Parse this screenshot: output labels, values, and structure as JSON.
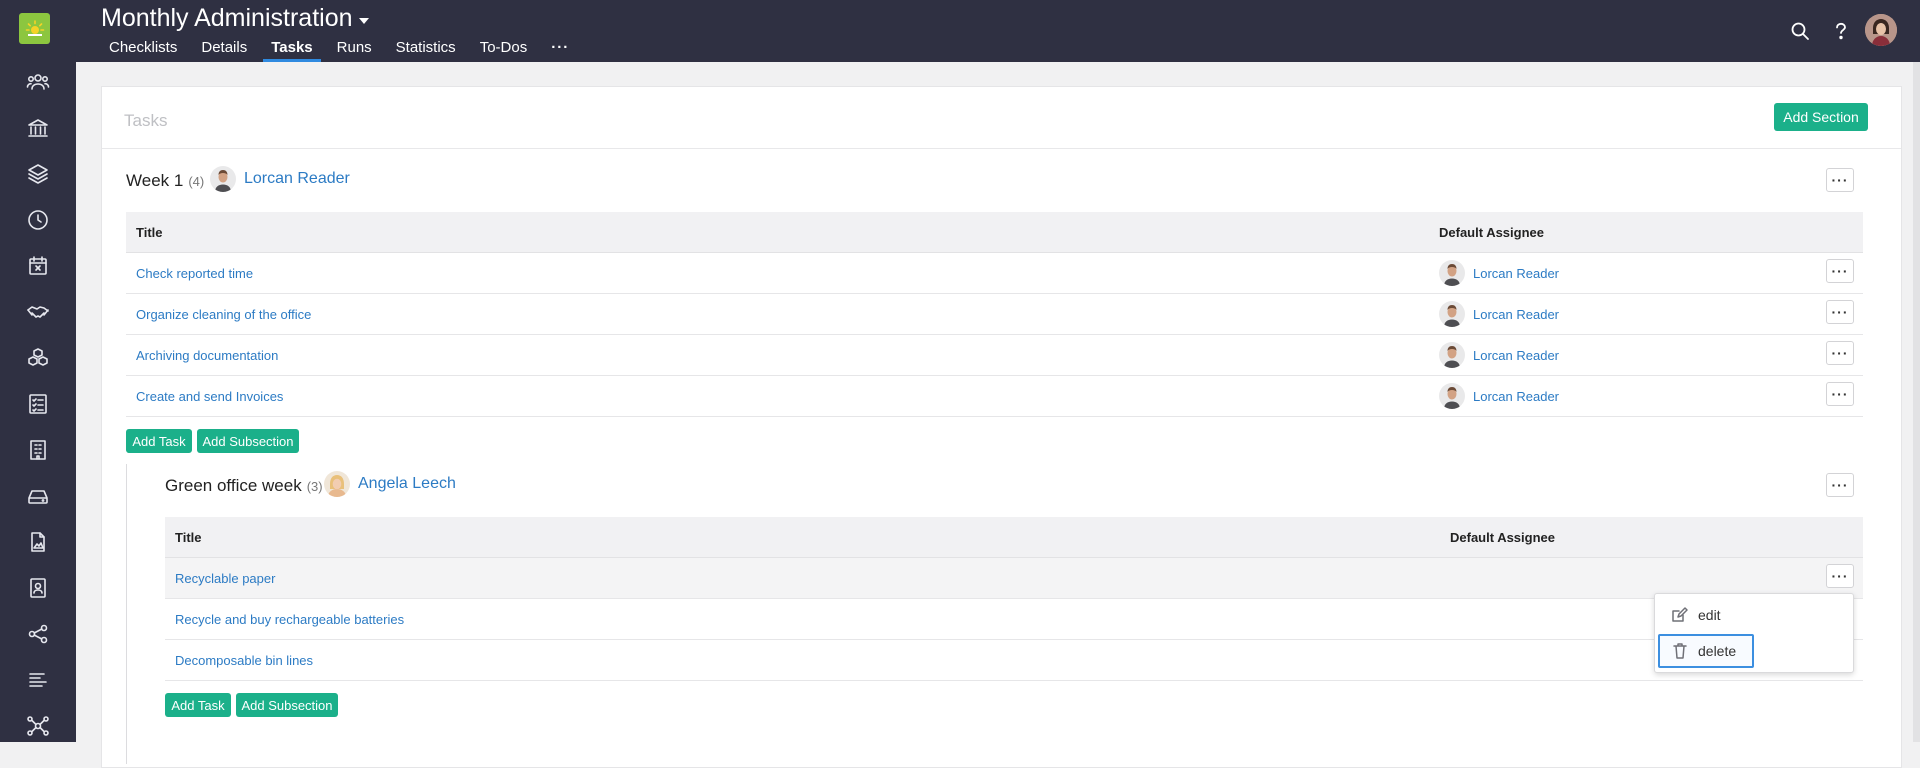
{
  "app": {
    "title": "Monthly Administration"
  },
  "tabs": [
    {
      "label": "Checklists"
    },
    {
      "label": "Details"
    },
    {
      "label": "Tasks",
      "active": true
    },
    {
      "label": "Runs"
    },
    {
      "label": "Statistics"
    },
    {
      "label": "To-Dos"
    },
    {
      "label": "···"
    }
  ],
  "sidebar_icons": [
    "users-icon",
    "bank-icon",
    "layers-icon",
    "clock-icon",
    "calendar-x-icon",
    "handshake-icon",
    "boxes-icon",
    "checklist-icon",
    "building-icon",
    "drive-icon",
    "document-image-icon",
    "contact-card-icon",
    "share-icon",
    "list-icon",
    "network-icon"
  ],
  "card": {
    "title": "Tasks",
    "add_section_label": "Add Section"
  },
  "sections": [
    {
      "title": "Week 1",
      "count": "(4)",
      "owner": "Lorcan Reader",
      "columns": {
        "title": "Title",
        "assignee": "Default Assignee"
      },
      "tasks": [
        {
          "title": "Check reported time",
          "assignee": "Lorcan Reader"
        },
        {
          "title": "Organize cleaning of the office",
          "assignee": "Lorcan Reader"
        },
        {
          "title": "Archiving documentation",
          "assignee": "Lorcan Reader"
        },
        {
          "title": "Create and send Invoices",
          "assignee": "Lorcan Reader"
        }
      ],
      "add_task_label": "Add Task",
      "add_subsection_label": "Add Subsection"
    },
    {
      "title": "Green office week",
      "count": "(3)",
      "owner": "Angela Leech",
      "columns": {
        "title": "Title",
        "assignee": "Default Assignee"
      },
      "tasks": [
        {
          "title": "Recyclable paper",
          "assignee": ""
        },
        {
          "title": "Recycle and buy rechargeable batteries",
          "assignee": ""
        },
        {
          "title": "Decomposable bin lines",
          "assignee": ""
        }
      ],
      "add_task_label": "Add Task",
      "add_subsection_label": "Add Subsection"
    }
  ],
  "context_menu": {
    "items": [
      {
        "label": "edit",
        "icon": "edit-icon"
      },
      {
        "label": "delete",
        "icon": "trash-icon"
      }
    ]
  },
  "colors": {
    "sidebar": "#2f3042",
    "accent_green": "#1bb08a",
    "link_blue": "#2c7bc4",
    "tab_underline": "#2f8ae0",
    "logo_green": "#8cc63f"
  }
}
